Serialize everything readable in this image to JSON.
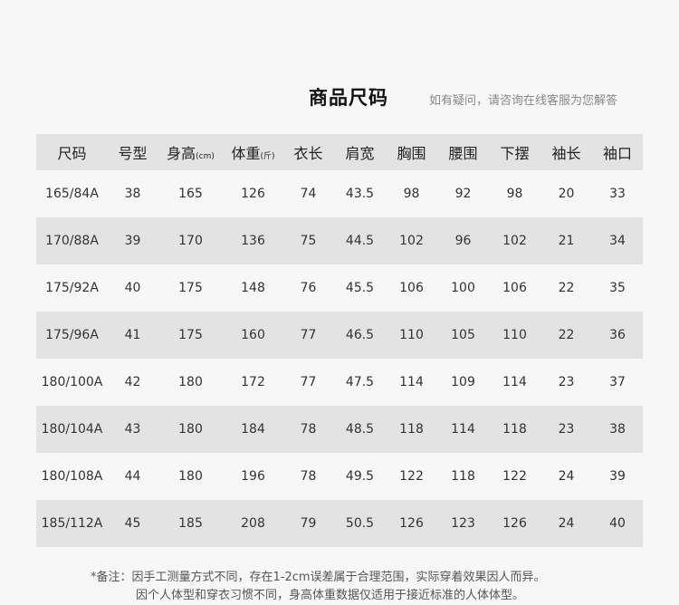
{
  "header": {
    "title": "商品尺码",
    "subtitle": "如有疑问，请咨询在线客服为您解答"
  },
  "table": {
    "columns": [
      {
        "label": "尺码",
        "unit": ""
      },
      {
        "label": "号型",
        "unit": ""
      },
      {
        "label": "身高",
        "unit": "(cm)"
      },
      {
        "label": "体重",
        "unit": "(斤)"
      },
      {
        "label": "衣长",
        "unit": ""
      },
      {
        "label": "肩宽",
        "unit": ""
      },
      {
        "label": "胸围",
        "unit": ""
      },
      {
        "label": "腰围",
        "unit": ""
      },
      {
        "label": "下摆",
        "unit": ""
      },
      {
        "label": "袖长",
        "unit": ""
      },
      {
        "label": "袖口",
        "unit": ""
      }
    ],
    "rows": [
      [
        "165/84A",
        "38",
        "165",
        "126",
        "74",
        "43.5",
        "98",
        "92",
        "98",
        "20",
        "33"
      ],
      [
        "170/88A",
        "39",
        "170",
        "136",
        "75",
        "44.5",
        "102",
        "96",
        "102",
        "21",
        "34"
      ],
      [
        "175/92A",
        "40",
        "175",
        "148",
        "76",
        "45.5",
        "106",
        "100",
        "106",
        "22",
        "35"
      ],
      [
        "175/96A",
        "41",
        "175",
        "160",
        "77",
        "46.5",
        "110",
        "105",
        "110",
        "22",
        "36"
      ],
      [
        "180/100A",
        "42",
        "180",
        "172",
        "77",
        "47.5",
        "114",
        "109",
        "114",
        "23",
        "37"
      ],
      [
        "180/104A",
        "43",
        "180",
        "184",
        "78",
        "48.5",
        "118",
        "114",
        "118",
        "23",
        "38"
      ],
      [
        "180/108A",
        "44",
        "180",
        "196",
        "78",
        "49.5",
        "122",
        "118",
        "122",
        "24",
        "39"
      ],
      [
        "185/112A",
        "45",
        "185",
        "208",
        "79",
        "50.5",
        "126",
        "123",
        "126",
        "24",
        "40"
      ]
    ]
  },
  "notes": {
    "line1": "*备注：因手工测量方式不同，存在1-2cm误差属于合理范围，实际穿着效果因人而异。",
    "line2": "因个人体型和穿衣习惯不同，身高体重数据仅适用于接近标准的人体体型。"
  }
}
